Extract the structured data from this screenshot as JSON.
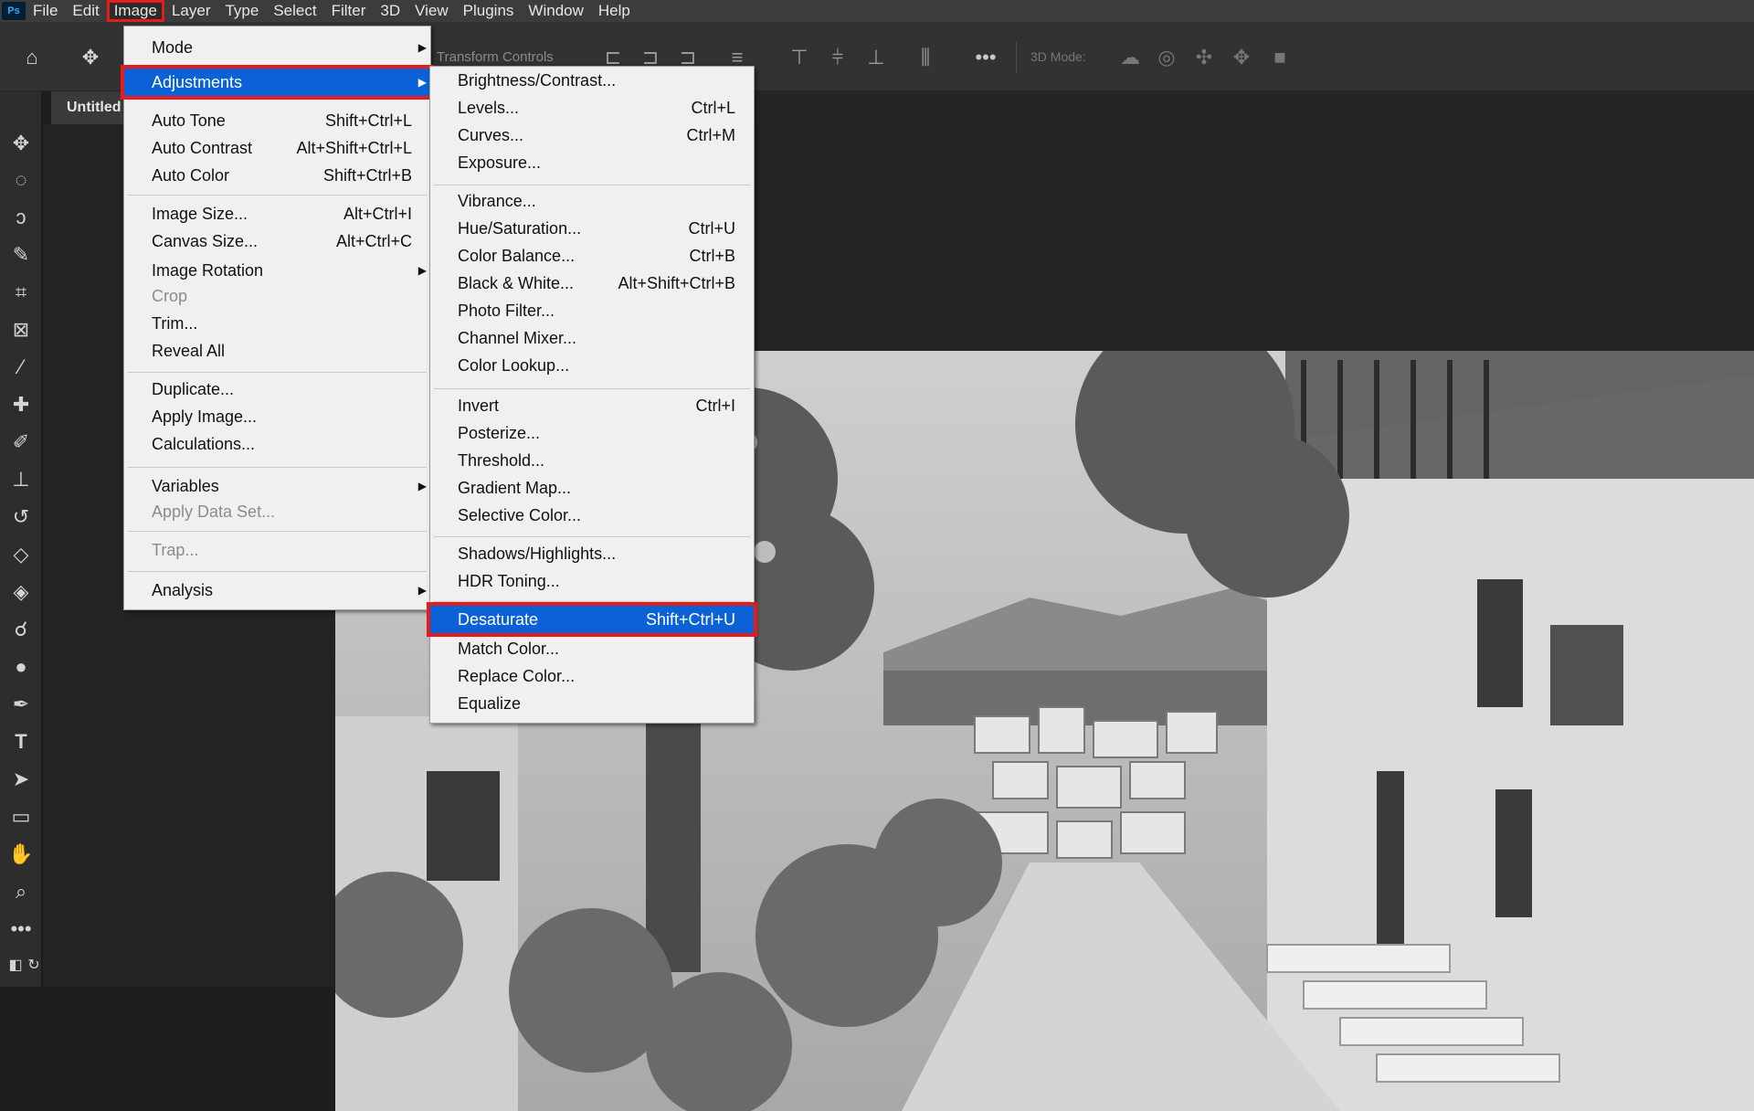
{
  "app": {
    "logo": "Ps"
  },
  "menubar": {
    "items": [
      "File",
      "Edit",
      "Image",
      "Layer",
      "Type",
      "Select",
      "Filter",
      "3D",
      "View",
      "Plugins",
      "Window",
      "Help"
    ],
    "active": "Image",
    "accent_color": "#e31d1d"
  },
  "options_bar": {
    "transform_controls": "Transform Controls",
    "three_d_mode": "3D Mode:",
    "icons": [
      "home-icon",
      "move-icon",
      "align-icons",
      "more-icon",
      "3d-orbit-icon",
      "3d-roll-icon",
      "3d-pan-icon",
      "3d-slide-icon",
      "3d-video-icon"
    ]
  },
  "document": {
    "tab_label": "Untitled"
  },
  "image_menu": {
    "items": [
      {
        "label": "Mode",
        "shortcut": "",
        "submenu": true
      },
      {
        "label": "Adjustments",
        "shortcut": "",
        "submenu": true,
        "highlighted": true
      },
      {
        "label": "Auto Tone",
        "shortcut": "Shift+Ctrl+L"
      },
      {
        "label": "Auto Contrast",
        "shortcut": "Alt+Shift+Ctrl+L"
      },
      {
        "label": "Auto Color",
        "shortcut": "Shift+Ctrl+B"
      },
      {
        "label": "Image Size...",
        "shortcut": "Alt+Ctrl+I"
      },
      {
        "label": "Canvas Size...",
        "shortcut": "Alt+Ctrl+C"
      },
      {
        "label": "Image Rotation",
        "shortcut": "",
        "submenu": true
      },
      {
        "label": "Crop",
        "shortcut": "",
        "disabled": true
      },
      {
        "label": "Trim...",
        "shortcut": ""
      },
      {
        "label": "Reveal All",
        "shortcut": ""
      },
      {
        "label": "Duplicate...",
        "shortcut": ""
      },
      {
        "label": "Apply Image...",
        "shortcut": ""
      },
      {
        "label": "Calculations...",
        "shortcut": ""
      },
      {
        "label": "Variables",
        "shortcut": "",
        "submenu": true
      },
      {
        "label": "Apply Data Set...",
        "shortcut": "",
        "disabled": true
      },
      {
        "label": "Trap...",
        "shortcut": "",
        "disabled": true
      },
      {
        "label": "Analysis",
        "shortcut": "",
        "submenu": true
      }
    ]
  },
  "adjustments_menu": {
    "items": [
      {
        "label": "Brightness/Contrast...",
        "shortcut": ""
      },
      {
        "label": "Levels...",
        "shortcut": "Ctrl+L"
      },
      {
        "label": "Curves...",
        "shortcut": "Ctrl+M"
      },
      {
        "label": "Exposure...",
        "shortcut": ""
      },
      {
        "label": "Vibrance...",
        "shortcut": ""
      },
      {
        "label": "Hue/Saturation...",
        "shortcut": "Ctrl+U"
      },
      {
        "label": "Color Balance...",
        "shortcut": "Ctrl+B"
      },
      {
        "label": "Black & White...",
        "shortcut": "Alt+Shift+Ctrl+B"
      },
      {
        "label": "Photo Filter...",
        "shortcut": ""
      },
      {
        "label": "Channel Mixer...",
        "shortcut": ""
      },
      {
        "label": "Color Lookup...",
        "shortcut": ""
      },
      {
        "label": "Invert",
        "shortcut": "Ctrl+I"
      },
      {
        "label": "Posterize...",
        "shortcut": ""
      },
      {
        "label": "Threshold...",
        "shortcut": ""
      },
      {
        "label": "Gradient Map...",
        "shortcut": ""
      },
      {
        "label": "Selective Color...",
        "shortcut": ""
      },
      {
        "label": "Shadows/Highlights...",
        "shortcut": ""
      },
      {
        "label": "HDR Toning...",
        "shortcut": ""
      },
      {
        "label": "Desaturate",
        "shortcut": "Shift+Ctrl+U",
        "highlighted": true
      },
      {
        "label": "Match Color...",
        "shortcut": ""
      },
      {
        "label": "Replace Color...",
        "shortcut": ""
      },
      {
        "label": "Equalize",
        "shortcut": ""
      }
    ]
  },
  "toolbar": {
    "tools": [
      "move-tool-icon",
      "marquee-tool-icon",
      "lasso-tool-icon",
      "quick-selection-tool-icon",
      "crop-tool-icon",
      "frame-tool-icon",
      "eyedropper-tool-icon",
      "healing-brush-tool-icon",
      "brush-tool-icon",
      "clone-stamp-tool-icon",
      "history-brush-tool-icon",
      "eraser-tool-icon",
      "paint-bucket-tool-icon",
      "smudge-tool-icon",
      "dodge-tool-icon",
      "pen-tool-icon",
      "type-tool-icon",
      "path-selection-tool-icon",
      "rectangle-tool-icon",
      "hand-tool-icon",
      "zoom-tool-icon",
      "more-tools-icon"
    ]
  },
  "colors": {
    "highlight": "#0a62d6",
    "menu_bg": "#f0f0f0"
  }
}
